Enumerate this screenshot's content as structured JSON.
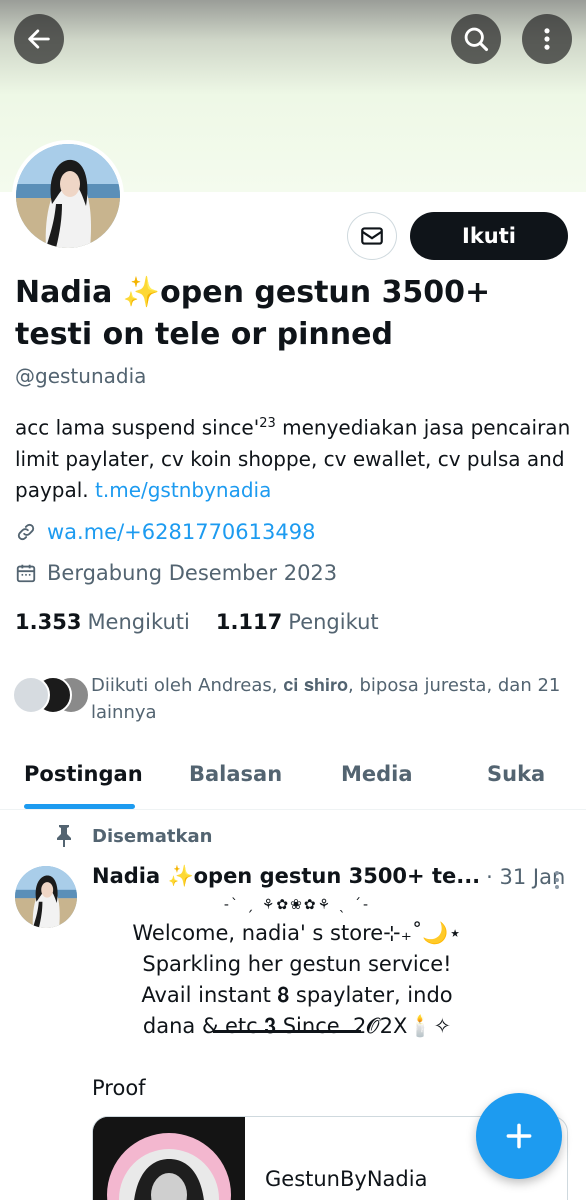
{
  "profile": {
    "display_name": "Nadia ✨open gestun 3500+ testi on tele or pinned",
    "handle": "@gestunadia",
    "bio_before_sup": "acc lama suspend since'",
    "bio_sup": "23",
    "bio_after_sup": " menyediakan jasa pencairan limit paylater, cv koin shoppe, cv ewallet, cv pulsa and paypal. ",
    "bio_link": "t.me/gstnbynadia",
    "website": "wa.me/+6281770613498",
    "joined": "Bergabung Desember 2023",
    "following_count": "1.353",
    "following_label": "Mengikuti",
    "followers_count": "1.117",
    "followers_label": "Pengikut",
    "followed_by": "Diikuti oleh Andreas, 𝐜𝐢 𝐬𝐡𝐢𝐫𝐨, biposa juresta, dan 21 lainnya"
  },
  "actions": {
    "follow_label": "Ikuti"
  },
  "tabs": [
    {
      "label": "Postingan",
      "active": true
    },
    {
      "label": "Balasan",
      "active": false
    },
    {
      "label": "Media",
      "active": false
    },
    {
      "label": "Suka",
      "active": false
    }
  ],
  "pinned_post": {
    "pinned_label": "Disematkan",
    "author": "Nadia ✨open gestun 3500+ te...",
    "date": "· 31 Jan",
    "decoration": "-ˋ ˏ ⚘✿❀✿⚘ ˎ ˊ-",
    "lines": [
      "Welcome, nadia' s store⊹₊˚🌙⋆",
      "Sparkling her gestun service!",
      "Avail instant 𝟖 spaylater, indo",
      "dana & etc 𝟑 Since. 2𝓞2X🕯️✧"
    ],
    "proof_label": "Proof",
    "card_title": "GestunByNadia"
  },
  "icons": {
    "back": "arrow-left-icon",
    "search": "search-icon",
    "more": "more-vertical-icon",
    "mail": "mail-icon",
    "link": "link-icon",
    "calendar": "calendar-icon",
    "pin": "pin-icon",
    "compose": "plus-icon"
  },
  "colors": {
    "accent": "#1d9bf0",
    "text": "#0f1419",
    "muted": "#536471",
    "follow_button": "#0f1419"
  }
}
